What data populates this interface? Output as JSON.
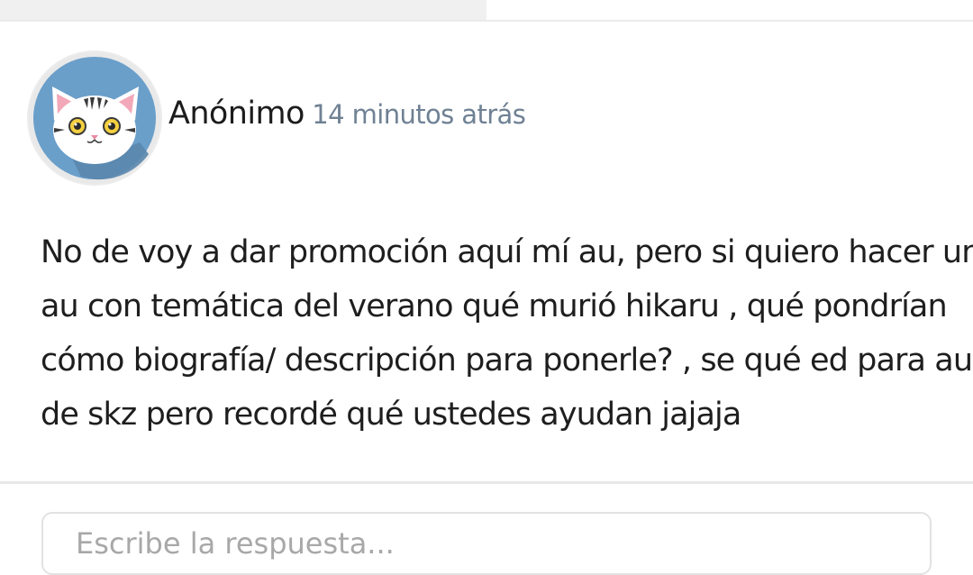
{
  "post": {
    "author": "Anónimo",
    "time_ago": "14 minutos atrás",
    "avatar_icon": "cat-face-icon",
    "body_lines": [
      "No de voy a dar promoción aquí mí au, pero si quiero hacer un",
      "au con temática del verano qué murió hikaru , qué pondrían",
      "cómo biografía/ descripción para ponerle? , se qué ed para au",
      "de skz pero recordé qué ustedes ayudan jajaja"
    ]
  },
  "comment": {
    "placeholder": "Escribe la respuesta..."
  },
  "colors": {
    "avatar_background": "#6a9fca",
    "avatar_shadow": "#5a86ad",
    "time_text": "#6f8194"
  }
}
